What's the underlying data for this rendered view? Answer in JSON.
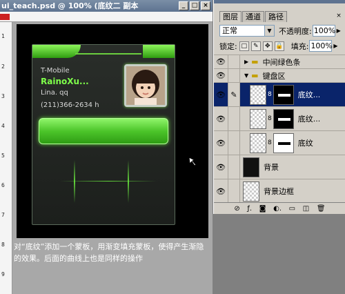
{
  "document": {
    "title": "ui_teach.psd @ 100% (底纹二 副本",
    "window_buttons": [
      "_",
      "□",
      "×"
    ],
    "ruler_left_numbers": [
      "1",
      "2",
      "3",
      "4",
      "5",
      "6",
      "7",
      "8",
      "9"
    ]
  },
  "card": {
    "carrier": "T-Mobile",
    "name": "RainoXu...",
    "company": "Lina. qq",
    "phone": "(211)366-2634 h"
  },
  "caption": "对“底纹”添加一个蒙板，用渐变填充蒙板，使得产生渐隐的效果。后面的曲线上也是同样的操作",
  "layers_panel": {
    "tabs": [
      "图层",
      "通道",
      "路径"
    ],
    "tab_close": "×",
    "blend_mode": "正常",
    "opacity_label": "不透明度:",
    "opacity_value": "100%",
    "lock_label": "锁定:",
    "lock_icons": [
      "□",
      "✎",
      "✥",
      "🔒"
    ],
    "fill_label": "填充:",
    "fill_value": "100%",
    "layers": [
      {
        "name": "中间绿色条",
        "type": "group",
        "collapsed": true
      },
      {
        "name": "键盘区",
        "type": "group",
        "collapsed": false
      },
      {
        "name": "底纹...",
        "type": "layer-mask",
        "selected": true,
        "mask": "black"
      },
      {
        "name": "底纹...",
        "type": "layer-mask",
        "selected": false,
        "mask": "black"
      },
      {
        "name": "底纹",
        "type": "layer-mask",
        "selected": false,
        "mask": "white"
      },
      {
        "name": "背景",
        "type": "layer",
        "thumb": "black"
      },
      {
        "name": "背景边框",
        "type": "layer",
        "thumb": "transparent"
      }
    ],
    "bottom_icons": [
      "link-icon",
      "fx-icon",
      "mask-icon",
      "adjustment-icon",
      "new-group-icon",
      "new-layer-icon",
      "trash-icon"
    ],
    "bottom_glyphs": [
      "⊘",
      "ƒ.",
      "◙",
      "◐.",
      "▭",
      "◫",
      "🗑"
    ]
  }
}
